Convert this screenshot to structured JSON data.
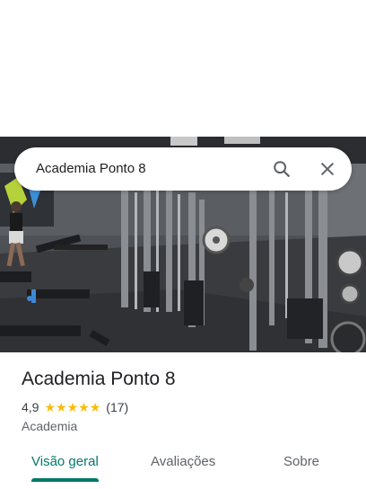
{
  "search": {
    "query": "Academia Ponto 8"
  },
  "place": {
    "name": "Academia Ponto 8",
    "rating": "4,9",
    "stars": 5,
    "review_count": "(17)",
    "category": "Academia"
  },
  "tabs": [
    {
      "label": "Visão geral",
      "active": true
    },
    {
      "label": "Avaliações",
      "active": false
    },
    {
      "label": "Sobre",
      "active": false
    }
  ],
  "colors": {
    "accent": "#00796b",
    "star": "#fbbc04"
  },
  "icons": {
    "search": "search-icon",
    "close": "close-icon",
    "star": "star-icon"
  }
}
